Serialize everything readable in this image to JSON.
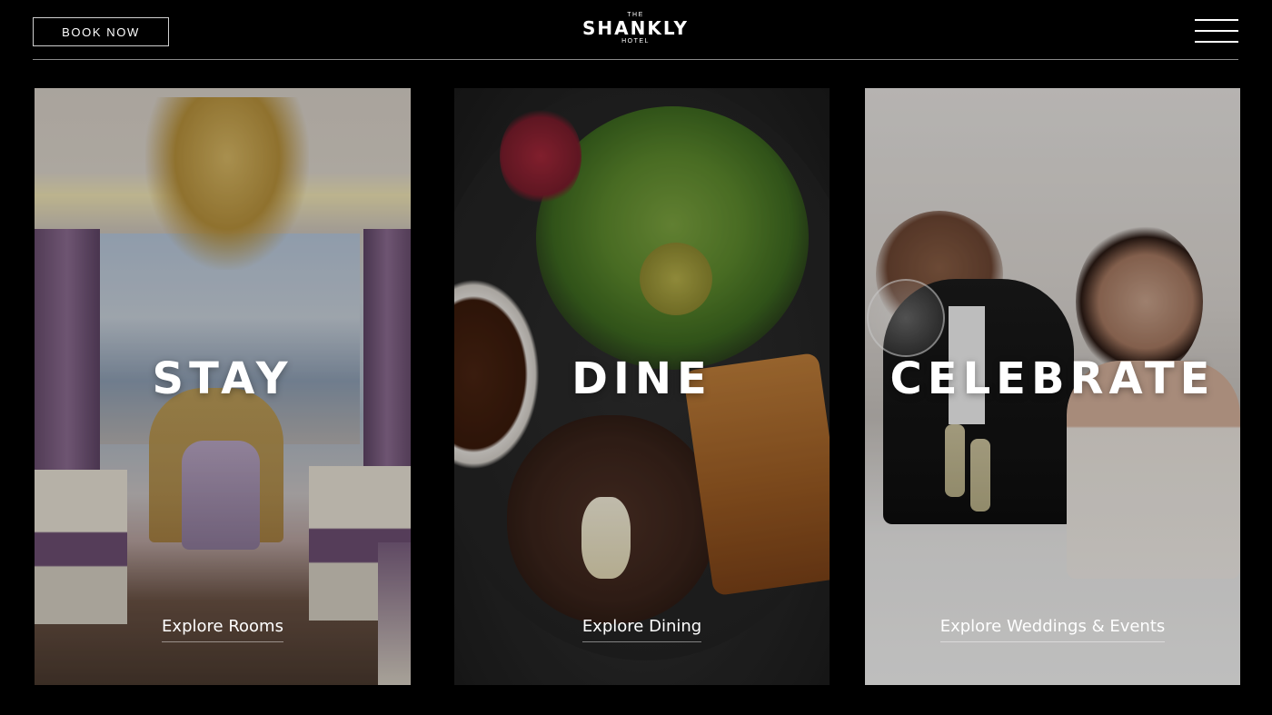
{
  "header": {
    "book_label": "BOOK NOW",
    "logo": {
      "the": "THE",
      "name": "SHANKLY",
      "hotel": "HOTEL"
    },
    "menu_icon": "hamburger-menu-icon"
  },
  "cards": [
    {
      "title": "STAY",
      "link": "Explore Rooms"
    },
    {
      "title": "DINE",
      "link": "Explore Dining"
    },
    {
      "title": "CELEBRATE",
      "link": "Explore Weddings & Events"
    }
  ],
  "colors": {
    "background": "#000000",
    "text": "#ffffff",
    "divider": "#8a8a8a"
  }
}
